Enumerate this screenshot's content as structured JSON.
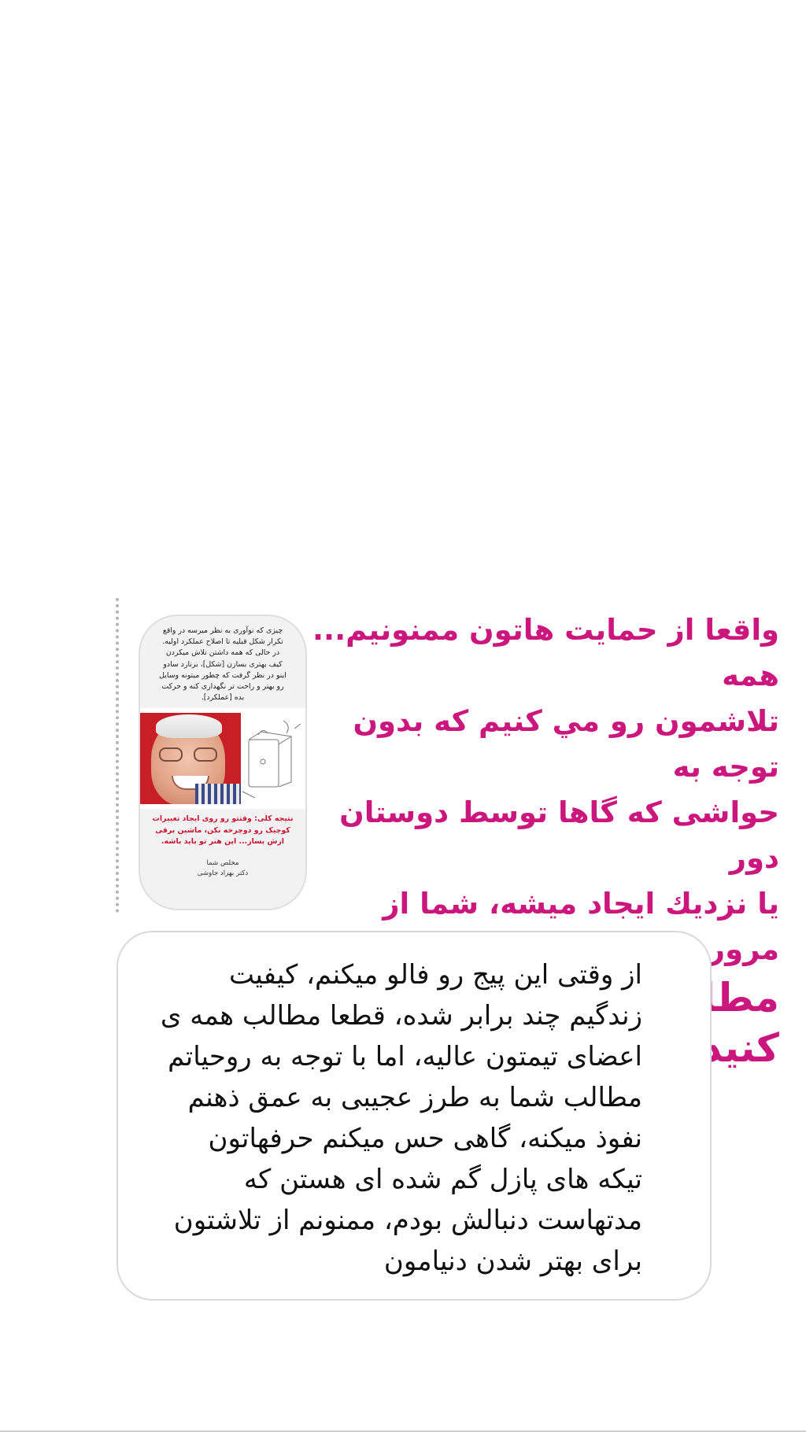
{
  "story_card": {
    "top_text": "چیزی که نوآوری به نظر میرسه در واقع تکرار شکل قبلیه تا اصلاح عملکرد اولیه. در حالی که همه داشتن تلاش میکردن کیف بهتری بسازن [شکل]، برنارد سادو اینو در نظر گرفت که چطور میتونه وسایل رو بهتر و راحت تر نگهداری کنه و حرکت بده [عملکرد].",
    "result_text": "نتیجه کلی: وقتتو رو روی ایجاد تغییرات کوچیک رو دوچرخه نکن، ماشین برقی ازش بساز... این هنر تو باید باشه.",
    "signoff_line1": "مخلص شما",
    "signoff_line2": "دکتر بهزاد جاوشی"
  },
  "headline": {
    "line1": "واقعا از حمايت هاتون ممنونيم... همه",
    "line2": "تلاشمون رو مي كنيم كه بدون توجه به",
    "line3": "حواشی كه گاها توسط دوستان دور",
    "line4": "يا نزديك ايجاد ميشه، شما از مرور",
    "line5": "مطالب اين پيج كيف كنيد."
  },
  "comment": {
    "line1": "از وقتی این پیج رو فالو میکنم، کیفیت",
    "line2": "زندگیم چند برابر شده، قطعا مطالب همه ی",
    "line3": "اعضای تیمتون عالیه، اما با توجه به روحیاتم",
    "line4": "مطالب شما به طرز عجیبی به عمق ذهنم",
    "line5": "نفوذ میکنه، گاهی حس میکنم حرفهاتون",
    "line6": "تیکه های پازل گم شده ای هستن که",
    "line7": "مدتهاست دنبالش بودم، ممنونم از تلاشتون",
    "line8": "برای بهتر شدن دنیامون"
  }
}
